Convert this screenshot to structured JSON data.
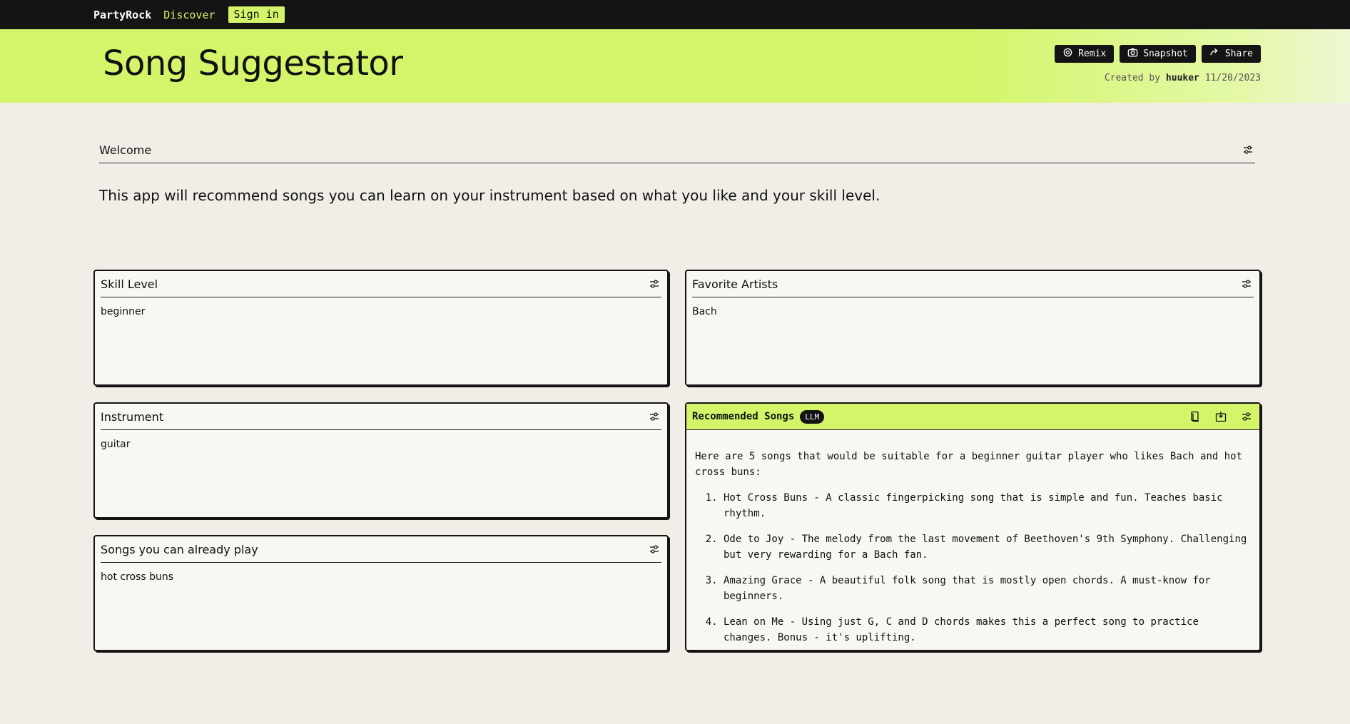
{
  "nav": {
    "brand": "PartyRock",
    "discover": "Discover",
    "sign_in": "Sign in"
  },
  "header": {
    "title": "Song Suggestator",
    "actions": [
      "Remix",
      "Snapshot",
      "Share"
    ],
    "created_prefix": "Created by",
    "author": "huuker",
    "date": "11/20/2023"
  },
  "welcome": {
    "title": "Welcome",
    "text": "This app will recommend songs you can learn on your instrument based on what you like and your skill level."
  },
  "widgets": {
    "skill_level": {
      "title": "Skill Level",
      "value": "beginner"
    },
    "favorite_artists": {
      "title": "Favorite Artists",
      "value": "Bach"
    },
    "instrument": {
      "title": "Instrument",
      "value": "guitar"
    },
    "songs_play": {
      "title": "Songs you can already play",
      "value": "hot cross buns"
    },
    "recommended": {
      "title": "Recommended Songs",
      "badge": "LLM",
      "intro": "Here are 5 songs that would be suitable for a beginner guitar player who likes Bach and hot cross buns:",
      "items": [
        "Hot Cross Buns - A classic fingerpicking song that is simple and fun. Teaches basic rhythm.",
        "Ode to Joy - The melody from the last movement of Beethoven's 9th Symphony. Challenging but very rewarding for a Bach fan.",
        "Amazing Grace - A beautiful folk song that is mostly open chords. A must-know for beginners.",
        "Lean on Me - Using just G, C and D chords makes this a perfect song to practice changes. Bonus - it's uplifting."
      ]
    }
  }
}
